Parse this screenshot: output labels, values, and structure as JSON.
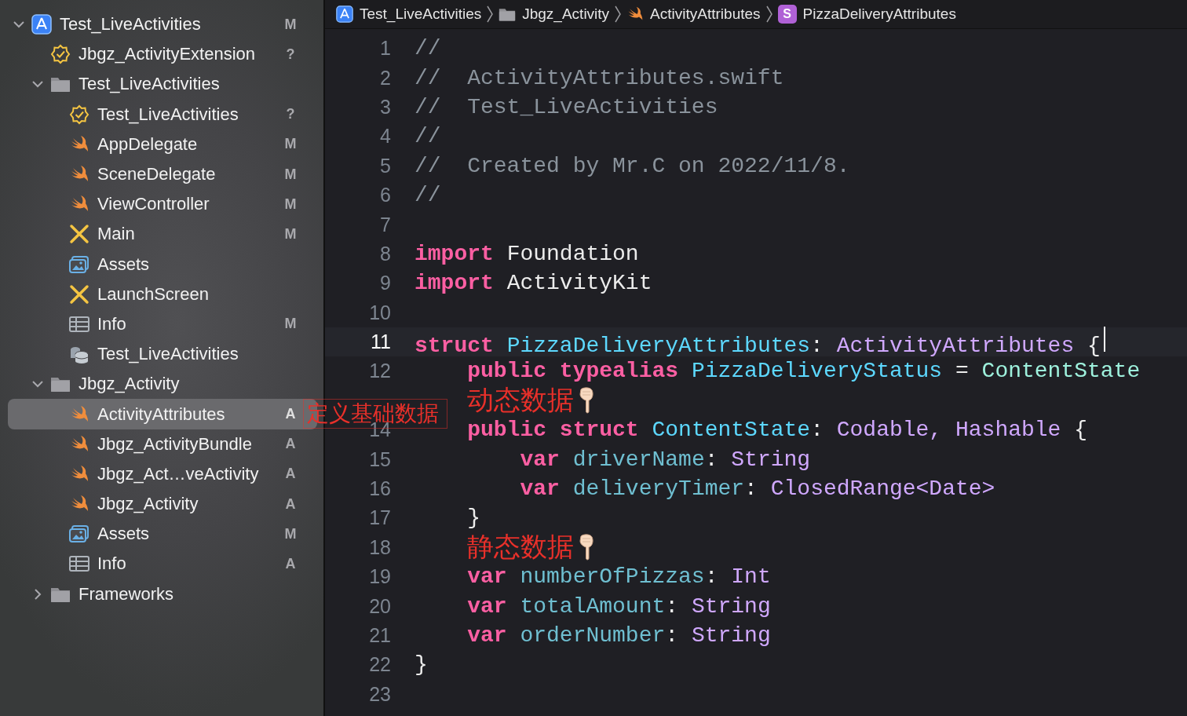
{
  "breadcrumb": [
    {
      "label": "Test_LiveActivities",
      "kind": "app"
    },
    {
      "label": "Jbgz_Activity",
      "kind": "folder"
    },
    {
      "label": "ActivityAttributes",
      "kind": "swift"
    },
    {
      "label": "PizzaDeliveryAttributes",
      "kind": "struct",
      "badge": "S"
    }
  ],
  "navigator": {
    "items": [
      {
        "label": "Test_LiveActivities",
        "kind": "app",
        "badge": "M",
        "expanded": true,
        "selected": false,
        "children": [
          {
            "label": "Jbgz_ActivityExtension",
            "kind": "extension",
            "badge": "?",
            "selected": false
          },
          {
            "label": "Test_LiveActivities",
            "kind": "folder",
            "expanded": true,
            "selected": false,
            "children": [
              {
                "label": "Test_LiveActivities",
                "kind": "extension",
                "badge": "?",
                "selected": false
              },
              {
                "label": "AppDelegate",
                "kind": "swift",
                "badge": "M",
                "selected": false
              },
              {
                "label": "SceneDelegate",
                "kind": "swift",
                "badge": "M",
                "selected": false
              },
              {
                "label": "ViewController",
                "kind": "swift",
                "badge": "M",
                "selected": false
              },
              {
                "label": "Main",
                "kind": "storyboard",
                "badge": "M",
                "selected": false
              },
              {
                "label": "Assets",
                "kind": "assets",
                "selected": false
              },
              {
                "label": "LaunchScreen",
                "kind": "storyboard",
                "selected": false
              },
              {
                "label": "Info",
                "kind": "plist",
                "badge": "M",
                "selected": false
              },
              {
                "label": "Test_LiveActivities",
                "kind": "datamodel",
                "selected": false
              }
            ]
          },
          {
            "label": "Jbgz_Activity",
            "kind": "folder",
            "expanded": true,
            "selected": false,
            "children": [
              {
                "label": "ActivityAttributes",
                "kind": "swift",
                "badge": "A",
                "selected": true,
                "note": "定义基础数据"
              },
              {
                "label": "Jbgz_ActivityBundle",
                "kind": "swift",
                "badge": "A",
                "selected": false
              },
              {
                "label": "Jbgz_Act…veActivity",
                "kind": "swift",
                "badge": "A",
                "selected": false
              },
              {
                "label": "Jbgz_Activity",
                "kind": "swift",
                "badge": "A",
                "selected": false
              },
              {
                "label": "Assets",
                "kind": "assets",
                "badge": "M",
                "selected": false
              },
              {
                "label": "Info",
                "kind": "plist",
                "badge": "A",
                "selected": false
              }
            ]
          },
          {
            "label": "Frameworks",
            "kind": "folder",
            "expanded": false,
            "selected": false
          }
        ]
      }
    ]
  },
  "editor": {
    "lines": [
      {
        "number": "1",
        "current": false,
        "tokens": [
          {
            "text": "//",
            "kind": "comment"
          }
        ]
      },
      {
        "number": "2",
        "current": false,
        "tokens": [
          {
            "text": "//  ActivityAttributes.swift",
            "kind": "comment"
          }
        ]
      },
      {
        "number": "3",
        "current": false,
        "tokens": [
          {
            "text": "//  Test_LiveActivities",
            "kind": "comment"
          }
        ]
      },
      {
        "number": "4",
        "current": false,
        "tokens": [
          {
            "text": "//",
            "kind": "comment"
          }
        ]
      },
      {
        "number": "5",
        "current": false,
        "tokens": [
          {
            "text": "//  Created by Mr.C on 2022/11/8.",
            "kind": "comment"
          }
        ]
      },
      {
        "number": "6",
        "current": false,
        "tokens": [
          {
            "text": "//",
            "kind": "comment"
          }
        ]
      },
      {
        "number": "7",
        "current": false
      },
      {
        "number": "8",
        "current": false,
        "tokens": [
          {
            "text": "import",
            "kind": "keyword"
          },
          {
            "text": "Foundation",
            "kind": "plain"
          }
        ]
      },
      {
        "number": "9",
        "current": false,
        "tokens": [
          {
            "text": "import",
            "kind": "keyword"
          },
          {
            "text": "ActivityKit",
            "kind": "plain"
          }
        ]
      },
      {
        "number": "10",
        "current": false
      },
      {
        "number": "11",
        "current": true,
        "tokens": [
          {
            "text": "struct",
            "kind": "keyword"
          },
          {
            "text": "PizzaDeliveryAttributes",
            "kind": "decl"
          },
          {
            "text": ":",
            "kind": "colon"
          },
          {
            "text": "ActivityAttributes",
            "kind": "systype"
          },
          {
            "text": "{",
            "kind": "plain"
          }
        ],
        "children": [
          {
            "number": "12",
            "current": false,
            "tokens": [
              {
                "text": "public",
                "kind": "keyword"
              },
              {
                "text": "typealias",
                "kind": "keyword"
              },
              {
                "text": "PizzaDeliveryStatus",
                "kind": "decl"
              },
              {
                "text": "=",
                "kind": "plain"
              },
              {
                "text": "ContentState",
                "kind": "typeref"
              }
            ]
          },
          {
            "current": false,
            "note": "动态数据"
          },
          {
            "number": "14",
            "current": false,
            "tokens": [
              {
                "text": "public",
                "kind": "keyword"
              },
              {
                "text": "struct",
                "kind": "keyword"
              },
              {
                "text": "ContentState",
                "kind": "decl"
              },
              {
                "text": ":",
                "kind": "colon"
              },
              {
                "text": "Codable,",
                "kind": "systype"
              },
              {
                "text": "Hashable",
                "kind": "systype"
              },
              {
                "text": "{",
                "kind": "plain"
              }
            ],
            "children": [
              {
                "number": "15",
                "current": false,
                "tokens": [
                  {
                    "text": "var",
                    "kind": "keyword"
                  },
                  {
                    "text": "driverName",
                    "kind": "prop"
                  },
                  {
                    "text": ":",
                    "kind": "colon"
                  },
                  {
                    "text": "String",
                    "kind": "systype"
                  }
                ]
              },
              {
                "number": "16",
                "current": false,
                "tokens": [
                  {
                    "text": "var",
                    "kind": "keyword"
                  },
                  {
                    "text": "deliveryTimer",
                    "kind": "prop"
                  },
                  {
                    "text": ":",
                    "kind": "colon"
                  },
                  {
                    "text": "ClosedRange<Date>",
                    "kind": "systype"
                  }
                ]
              }
            ]
          },
          {
            "number": "17",
            "current": false,
            "tokens": [
              {
                "text": "}",
                "kind": "plain"
              }
            ]
          },
          {
            "number": "18",
            "current": false,
            "note": "静态数据"
          },
          {
            "number": "19",
            "current": false,
            "tokens": [
              {
                "text": "var",
                "kind": "keyword"
              },
              {
                "text": "numberOfPizzas",
                "kind": "prop"
              },
              {
                "text": ":",
                "kind": "colon"
              },
              {
                "text": "Int",
                "kind": "systype"
              }
            ]
          },
          {
            "number": "20",
            "current": false,
            "tokens": [
              {
                "text": "var",
                "kind": "keyword"
              },
              {
                "text": "totalAmount",
                "kind": "prop"
              },
              {
                "text": ":",
                "kind": "colon"
              },
              {
                "text": "String",
                "kind": "systype"
              }
            ]
          },
          {
            "number": "21",
            "current": false,
            "tokens": [
              {
                "text": "var",
                "kind": "keyword"
              },
              {
                "text": "orderNumber",
                "kind": "prop"
              },
              {
                "text": ":",
                "kind": "colon"
              },
              {
                "text": "String",
                "kind": "systype"
              }
            ]
          }
        ]
      },
      {
        "number": "22",
        "current": false,
        "tokens": [
          {
            "text": "}",
            "kind": "plain"
          }
        ]
      },
      {
        "number": "23",
        "current": false
      }
    ]
  }
}
